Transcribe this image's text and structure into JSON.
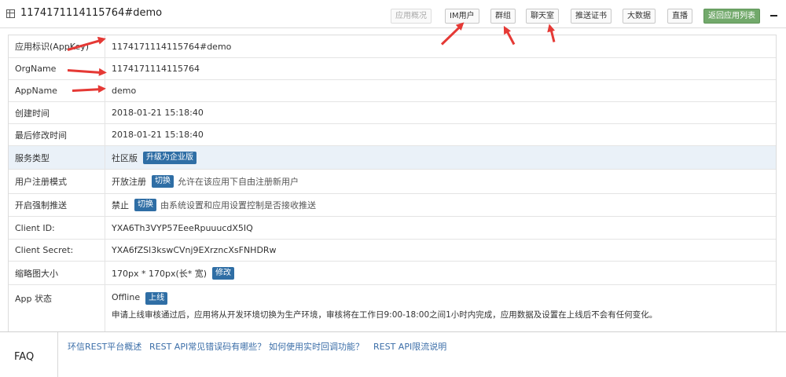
{
  "header": {
    "title": "1174171114115764#demo",
    "buttons": {
      "app_overview": "应用概况",
      "im_users": "IM用户",
      "groups": "群组",
      "chatrooms": "聊天室",
      "push_cert": "推送证书",
      "big_data": "大数据",
      "live": "直播",
      "back_to_list": "返回应用列表"
    }
  },
  "details": {
    "appkey_label": "应用标识(AppKey)",
    "appkey_value": "1174171114115764#demo",
    "orgname_label": "OrgName",
    "orgname_value": "1174171114115764",
    "appname_label": "AppName",
    "appname_value": "demo",
    "created_label": "创建时间",
    "created_value": "2018-01-21 15:18:40",
    "modified_label": "最后修改时间",
    "modified_value": "2018-01-21 15:18:40",
    "service_label": "服务类型",
    "service_value": "社区版",
    "service_upgrade": "升级为企业版",
    "register_label": "用户注册模式",
    "register_value": "开放注册",
    "register_toggle": "切换",
    "register_hint": "允许在该应用下自由注册新用户",
    "push_label": "开启强制推送",
    "push_value": "禁止",
    "push_toggle": "切换",
    "push_hint": "由系统设置和应用设置控制是否接收推送",
    "client_id_label": "Client ID:",
    "client_id_value": "YXA6Th3VYP57EeeRpuuucdX5IQ",
    "client_secret_label": "Client Secret:",
    "client_secret_value": "YXA6fZSl3kswCVnj9EXrzncXsFNHDRw",
    "thumb_label": "缩略图大小",
    "thumb_value": "170px * 170px(长* 宽)",
    "thumb_edit": "修改",
    "status_label": "App 状态",
    "status_value": "Offline",
    "status_online": "上线",
    "status_notice": "申请上线审核通过后，应用将从开发环境切换为生产环境，审核将在工作日9:00-18:00之间1小时内完成，应用数据及设置在上线后不会有任何变化。"
  },
  "faq": {
    "label": "FAQ",
    "links": [
      "环信REST平台概述",
      "REST API常见错误码有哪些？",
      "如何使用实时回调功能？",
      "REST API限流说明"
    ]
  },
  "colors": {
    "badge_blue": "#2f6ea5",
    "back_button_green": "#72a96b",
    "annotation_arrow_red": "#e53935",
    "faq_link_blue": "#3b6ea8",
    "highlight_row": "#eaf1f8"
  }
}
